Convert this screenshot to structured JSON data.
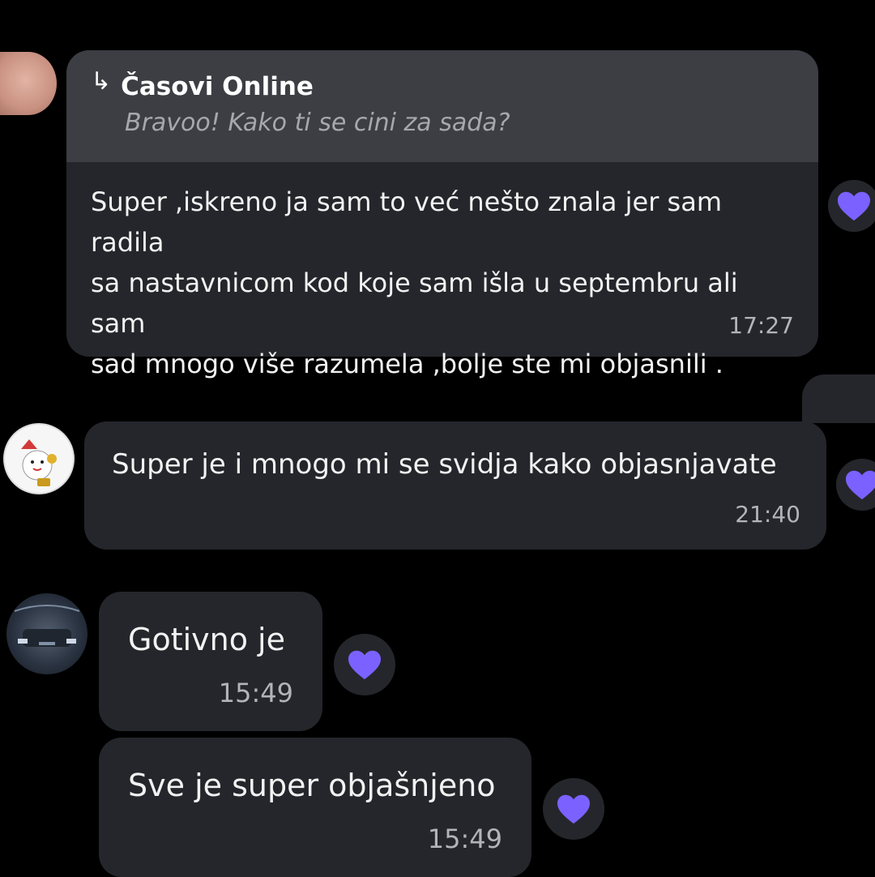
{
  "messages": [
    {
      "reply": {
        "title": "Časovi Online",
        "quote": "Bravoo! Kako ti se cini za sada?"
      },
      "lines": [
        "Super ,iskreno ja sam to već nešto znala jer sam radila",
        "sa nastavnicom kod koje sam išla u septembru ali sam",
        "sad mnogo više razumela ,bolje ste mi objasnili ."
      ],
      "time": "17:27",
      "reaction": "heart-icon"
    },
    {
      "text": "Super je i mnogo mi se svidja kako objasnjavate",
      "time": "21:40",
      "reaction": "heart-icon"
    },
    {
      "text": "Gotivno je",
      "time": "15:49",
      "reaction": "heart-icon"
    },
    {
      "text": "Sve je super objašnjeno",
      "time": "15:49",
      "reaction": "heart-icon"
    }
  ],
  "colors": {
    "background": "#000000",
    "bubble": "#25262b",
    "reply_block": "#3c3e44",
    "heart": "#7b61ff"
  }
}
